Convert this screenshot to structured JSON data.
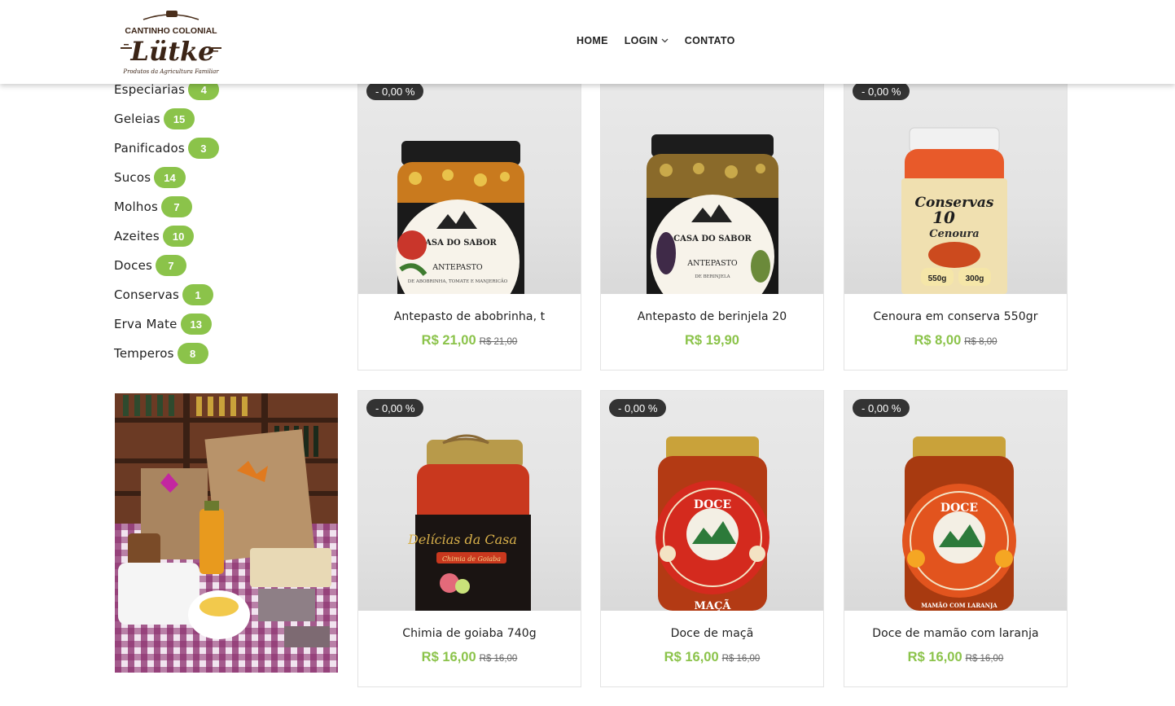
{
  "header": {
    "brand_line1": "CANTINHO COLONIAL",
    "brand_name": "Lütke",
    "brand_tagline": "Produtos da Agricultura Familiar",
    "nav": [
      {
        "label": "HOME"
      },
      {
        "label": "LOGIN"
      },
      {
        "label": "CONTATO"
      }
    ]
  },
  "sidebar": {
    "categories": [
      {
        "name": "Especiarias",
        "count": "4"
      },
      {
        "name": "Geleias",
        "count": "15"
      },
      {
        "name": "Panificados",
        "count": "3"
      },
      {
        "name": "Sucos",
        "count": "14"
      },
      {
        "name": "Molhos",
        "count": "7"
      },
      {
        "name": "Azeites",
        "count": "10"
      },
      {
        "name": "Doces",
        "count": "7"
      },
      {
        "name": "Conservas",
        "count": "1"
      },
      {
        "name": "Erva Mate",
        "count": "13"
      },
      {
        "name": "Temperos",
        "count": "8"
      }
    ]
  },
  "products": [
    {
      "name": "Antepasto de abobrinha, t",
      "price": "R$ 21,00",
      "old_price": "R$ 21,00",
      "sale": "- 0,00 %",
      "label_text": "ANTEPASTO",
      "label_sub": "DE ABOBRINHA, TOMATE E MANJERICÃO"
    },
    {
      "name": "Antepasto de berinjela 20",
      "price": "R$ 19,90",
      "old_price": "",
      "sale": "",
      "label_text": "ANTEPASTO",
      "label_sub": "DE BERINJELA"
    },
    {
      "name": "Cenoura em conserva 550gr",
      "price": "R$ 8,00",
      "old_price": "R$ 8,00",
      "sale": "- 0,00 %",
      "label_text": "Conservas",
      "label_sub": "Cenoura"
    },
    {
      "name": "Chimia de goiaba 740g",
      "price": "R$ 16,00",
      "old_price": "R$ 16,00",
      "sale": "- 0,00 %",
      "label_text": "Delícias da Casa",
      "label_sub": "Chimia de Goiaba"
    },
    {
      "name": "Doce de maçã",
      "price": "R$ 16,00",
      "old_price": "R$ 16,00",
      "sale": "- 0,00 %",
      "label_text": "DOCE",
      "label_sub": "MAÇÃ"
    },
    {
      "name": "Doce de mamão com laranja",
      "price": "R$ 16,00",
      "old_price": "R$ 16,00",
      "sale": "- 0,00 %",
      "label_text": "DOCE",
      "label_sub": "MAMÃO COM LARANJA"
    }
  ],
  "colors": {
    "accent": "#8bc34a",
    "badge_dark": "#333333"
  }
}
